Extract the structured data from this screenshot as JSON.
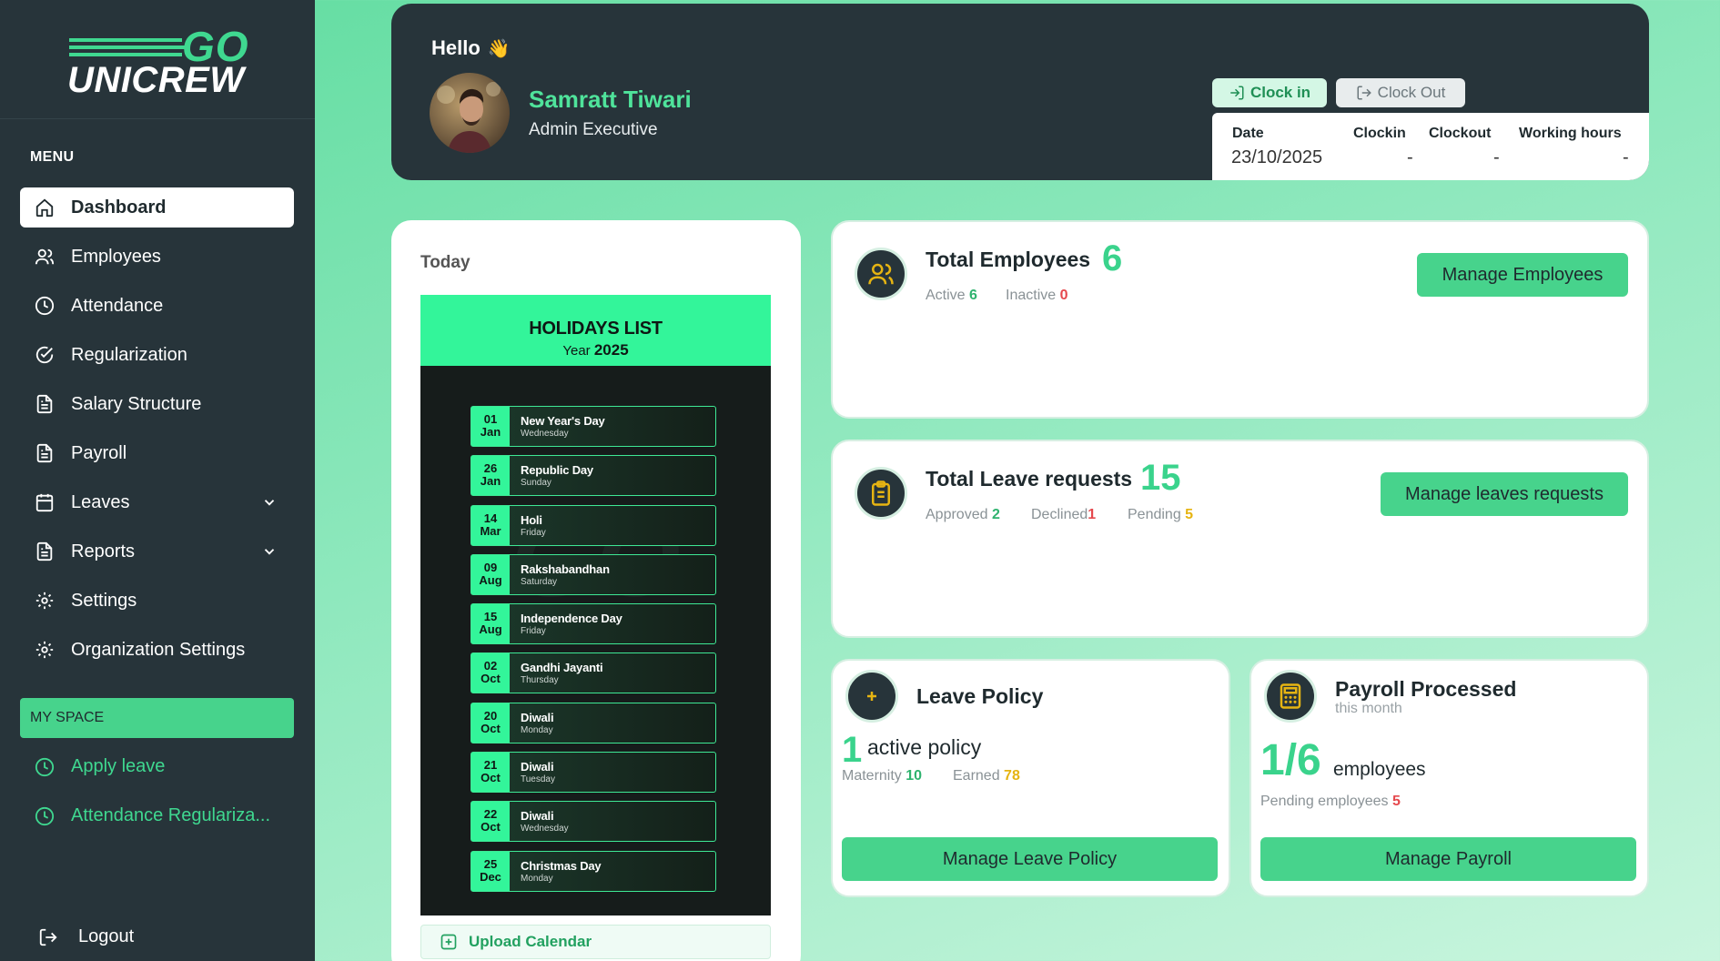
{
  "brand": {
    "logo_go": "GO",
    "logo_unicrew": "UNICREW"
  },
  "sidebar": {
    "menu_heading": "MENU",
    "items": [
      {
        "label": "Dashboard",
        "icon": "home-icon",
        "active": true
      },
      {
        "label": "Employees",
        "icon": "users-icon"
      },
      {
        "label": "Attendance",
        "icon": "clock-icon"
      },
      {
        "label": "Regularization",
        "icon": "check-circle-icon"
      },
      {
        "label": "Salary Structure",
        "icon": "document-icon"
      },
      {
        "label": "Payroll",
        "icon": "document-icon"
      },
      {
        "label": "Leaves",
        "icon": "calendar-icon",
        "has_submenu": true
      },
      {
        "label": "Reports",
        "icon": "document-icon",
        "has_submenu": true
      },
      {
        "label": "Settings",
        "icon": "gear-icon"
      },
      {
        "label": "Organization Settings",
        "icon": "gear-icon"
      }
    ],
    "myspace_heading": "MY SPACE",
    "myspace_items": [
      {
        "label": "Apply leave",
        "icon": "clock-icon"
      },
      {
        "label": "Attendance Regulariza...",
        "icon": "clock-icon"
      }
    ],
    "logout_label": "Logout"
  },
  "header": {
    "greeting": "Hello",
    "wave_emoji": "👋",
    "user_name": "Samratt Tiwari",
    "user_role": "Admin Executive",
    "clock_in_label": "Clock in",
    "clock_out_label": "Clock Out",
    "table": {
      "date_label": "Date",
      "clockin_label": "Clockin",
      "clockout_label": "Clockout",
      "hours_label": "Working hours",
      "date_value": "23/10/2025",
      "clockin_value": "-",
      "clockout_value": "-",
      "hours_value": "-"
    }
  },
  "today": {
    "label": "Today",
    "holidays_title": "HOLIDAYS LIST",
    "year_label": "Year",
    "year_value": "2025",
    "holidays": [
      {
        "day": "01",
        "month": "Jan",
        "name": "New Year's Day",
        "weekday": "Wednesday"
      },
      {
        "day": "26",
        "month": "Jan",
        "name": "Republic Day",
        "weekday": "Sunday"
      },
      {
        "day": "14",
        "month": "Mar",
        "name": "Holi",
        "weekday": "Friday"
      },
      {
        "day": "09",
        "month": "Aug",
        "name": "Rakshabandhan",
        "weekday": "Saturday"
      },
      {
        "day": "15",
        "month": "Aug",
        "name": "Independence Day",
        "weekday": "Friday"
      },
      {
        "day": "02",
        "month": "Oct",
        "name": "Gandhi Jayanti",
        "weekday": "Thursday"
      },
      {
        "day": "20",
        "month": "Oct",
        "name": "Diwali",
        "weekday": "Monday"
      },
      {
        "day": "21",
        "month": "Oct",
        "name": "Diwali",
        "weekday": "Tuesday"
      },
      {
        "day": "22",
        "month": "Oct",
        "name": "Diwali",
        "weekday": "Wednesday"
      },
      {
        "day": "25",
        "month": "Dec",
        "name": "Christmas Day",
        "weekday": "Monday"
      }
    ],
    "upload_label": "Upload Calendar"
  },
  "employees_card": {
    "title": "Total Employees",
    "total": "6",
    "active_label": "Active",
    "active_value": "6",
    "inactive_label": "Inactive",
    "inactive_value": "0",
    "button_label": "Manage Employees"
  },
  "leave_requests_card": {
    "title": "Total Leave requests",
    "total": "15",
    "approved_label": "Approved",
    "approved_value": "2",
    "declined_label": "Declined",
    "declined_value": "1",
    "pending_label": "Pending",
    "pending_value": "5",
    "button_label": "Manage leaves requests"
  },
  "leave_policy_card": {
    "title": "Leave Policy",
    "count": "1",
    "count_label": "active policy",
    "maternity_label": "Maternity",
    "maternity_value": "10",
    "earned_label": "Earned",
    "earned_value": "78",
    "button_label": "Manage Leave Policy"
  },
  "payroll_card": {
    "title": "Payroll Processed",
    "subtitle": "this month",
    "ratio": "1/6",
    "ratio_label": "employees",
    "pending_label": "Pending employees",
    "pending_value": "5",
    "button_label": "Manage Payroll"
  },
  "colors": {
    "sidebar_bg": "#27343a",
    "accent": "#47d38c",
    "accent_bright": "#33f59a",
    "danger": "#e5484d",
    "warning": "#e6b412"
  }
}
